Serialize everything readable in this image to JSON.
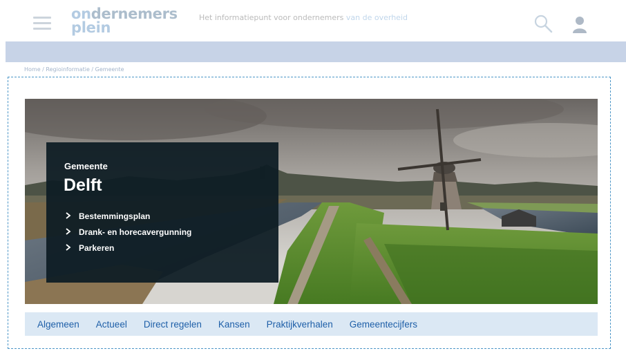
{
  "header": {
    "logo_line1_prefix": "on",
    "logo_line1_rest": "dernemers",
    "logo_line2": "plein",
    "tagline": "Het informatiepunt voor ondernemers",
    "tagline_highlight": "van de overheid",
    "icons": {
      "menu": "hamburger-icon",
      "search": "search-icon",
      "user": "user-icon"
    }
  },
  "breadcrumb": {
    "items": [
      "Home",
      "Regioinformatie",
      "Gemeente"
    ],
    "separator": "/"
  },
  "hero": {
    "subtitle": "Gemeente",
    "title": "Delft",
    "links": [
      "Bestemmingsplan",
      "Drank- en horecavergunning",
      "Parkeren"
    ],
    "image_description_icon": "windmill-landscape-image"
  },
  "tabs": [
    "Algemeen",
    "Actueel",
    "Direct regelen",
    "Kansen",
    "Praktijkverhalen",
    "Gemeentecijfers"
  ],
  "colors": {
    "brand_dark": "#27557c",
    "brand_blue": "#3a79b5",
    "tab_text": "#1e5fa8",
    "tab_bg": "#dbe8f4",
    "overlay_bg": "#0e1d24",
    "frame_dashed": "#4a95c7"
  }
}
